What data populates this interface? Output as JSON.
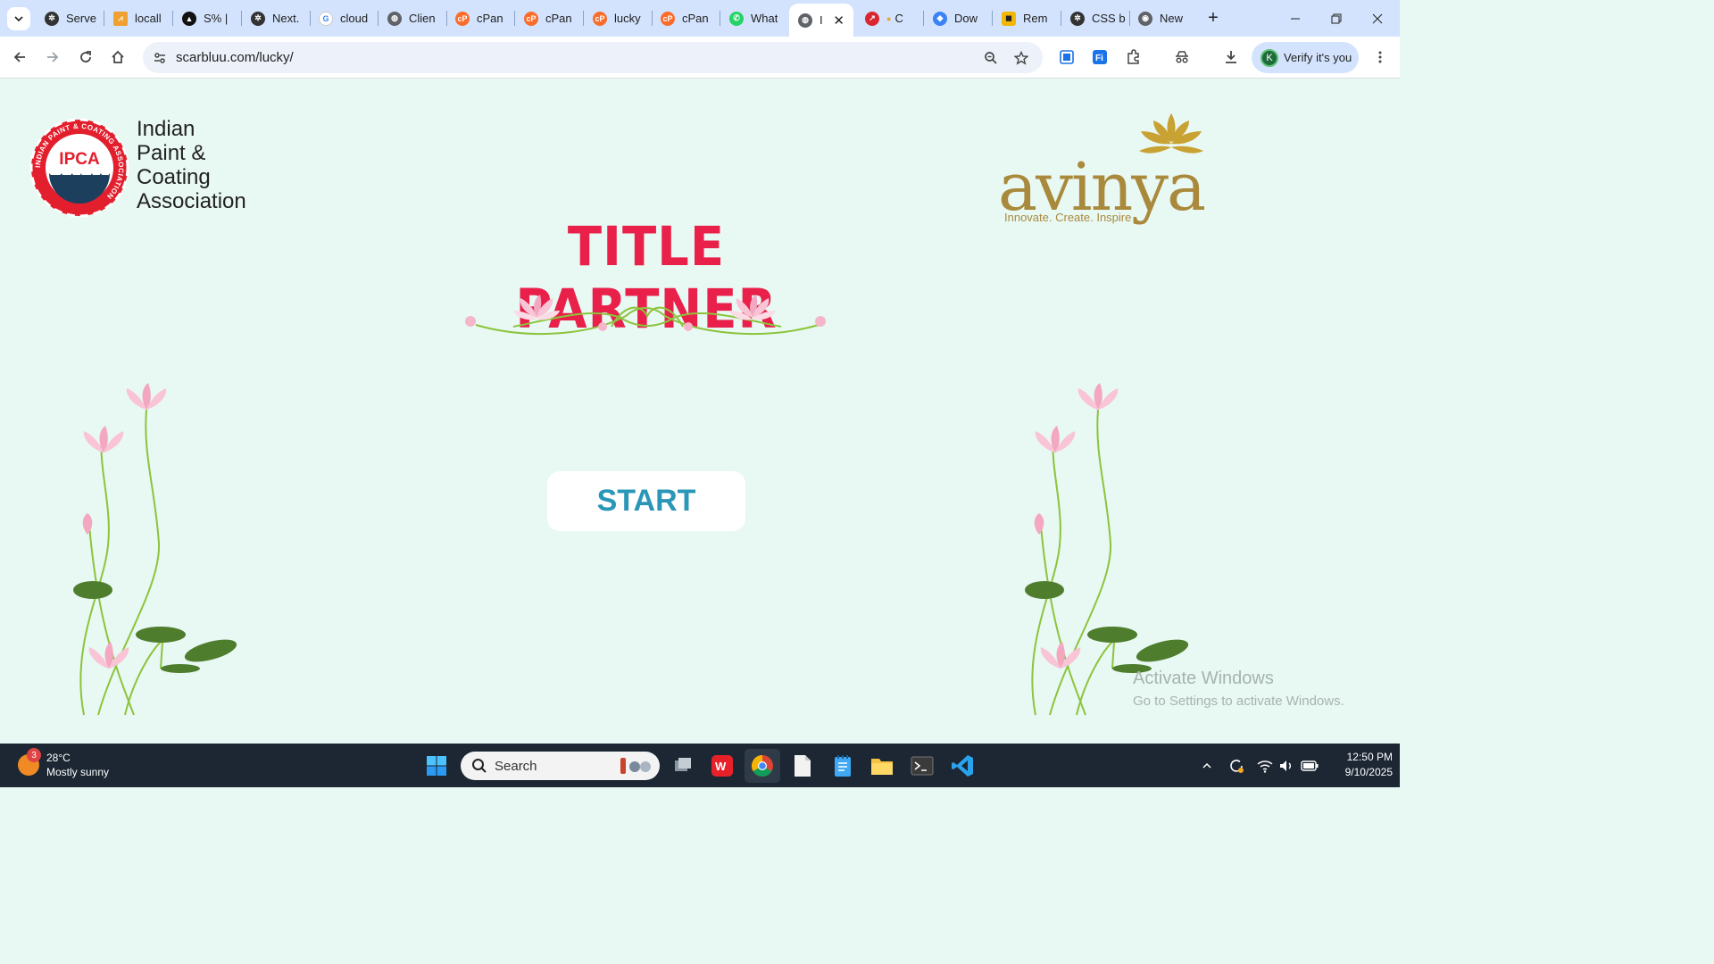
{
  "browser": {
    "tabs": [
      {
        "title": "Serve",
        "icon": "openai-icon"
      },
      {
        "title": "locall",
        "icon": "pma-icon"
      },
      {
        "title": "S% |",
        "icon": "triangle-icon"
      },
      {
        "title": "Next.",
        "icon": "openai-icon"
      },
      {
        "title": "cloud",
        "icon": "google-icon"
      },
      {
        "title": "Clien",
        "icon": "globe-icon"
      },
      {
        "title": "cPan",
        "icon": "cpanel-icon"
      },
      {
        "title": "cPan",
        "icon": "cpanel-icon"
      },
      {
        "title": "lucky",
        "icon": "cpanel-icon"
      },
      {
        "title": "cPan",
        "icon": "cpanel-icon"
      },
      {
        "title": "What",
        "icon": "whatsapp-icon"
      },
      {
        "title": "I",
        "icon": "globe-icon",
        "active": true
      },
      {
        "title": "C",
        "icon": "red-circle-icon"
      },
      {
        "title": "Dow",
        "icon": "gemini-icon"
      },
      {
        "title": "Rem",
        "icon": "graduation-icon"
      },
      {
        "title": "CSS b",
        "icon": "openai-icon"
      },
      {
        "title": "New",
        "icon": "chrome-icon"
      }
    ],
    "url": "scarbluu.com/lucky/",
    "profile_label": "Verify it's you",
    "profile_initial": "K"
  },
  "page": {
    "ipca_badge": "IPCA",
    "ipca_ring_text": "INDIAN PAINT & COATING ASSOCIATION",
    "ipca_name_lines": [
      "Indian",
      "Paint &",
      "Coating",
      "Association"
    ],
    "avinya_word": "avinya",
    "avinya_tagline": "Innovate. Create. Inspire",
    "heading": "TITLE PARTNER",
    "start_label": "START",
    "watermark_title": "Activate Windows",
    "watermark_sub": "Go to Settings to activate Windows."
  },
  "taskbar": {
    "weather_temp": "28°C",
    "weather_desc": "Mostly sunny",
    "weather_badge": "3",
    "search_placeholder": "Search",
    "time": "12:50 PM",
    "date": "9/10/2025"
  },
  "colors": {
    "accent_red": "#e8204a",
    "start_text": "#2a96b8",
    "page_bg": "#e8f8f3",
    "avinya_gold": "#a98a3c"
  }
}
